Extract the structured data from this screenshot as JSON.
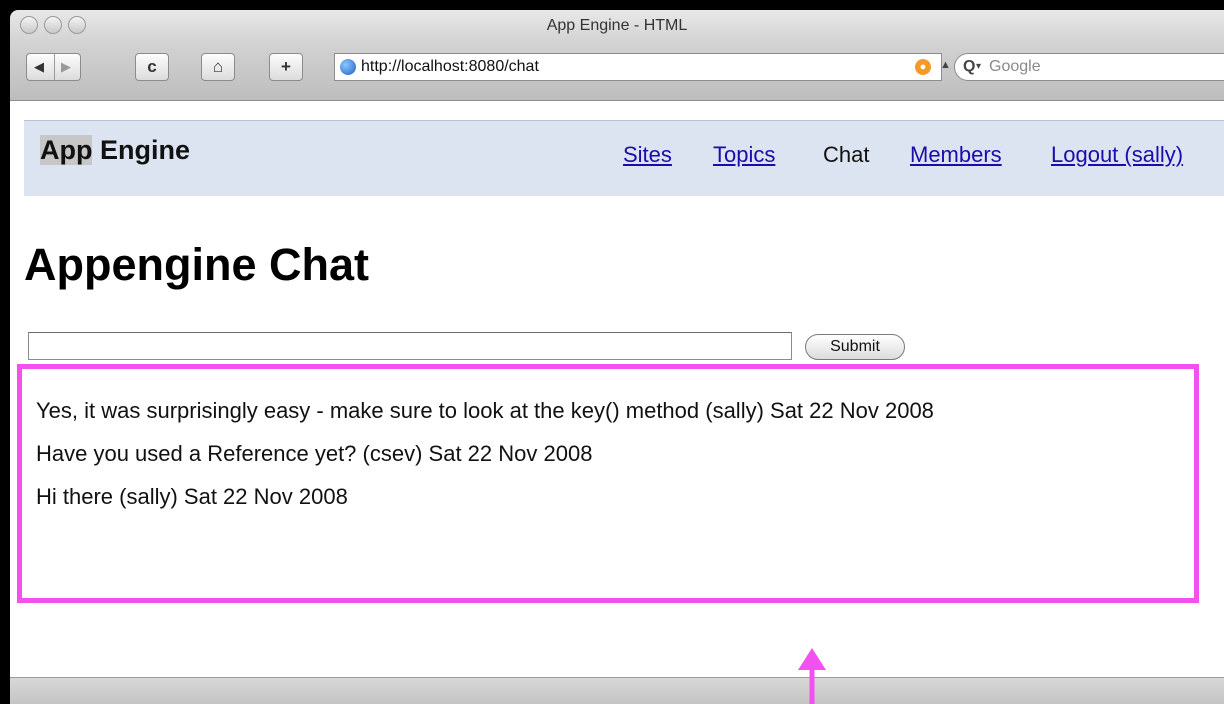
{
  "window": {
    "title": "App Engine - HTML"
  },
  "toolbar": {
    "back_icon": "back-arrow-icon",
    "forward_icon": "forward-arrow-icon",
    "reload_label": "c",
    "home_icon": "home-icon",
    "add_label": "+",
    "url": "http://localhost:8080/chat",
    "search_placeholder": "Google",
    "search_icon_label": "Q"
  },
  "nav": {
    "brand_highlight": "App",
    "brand_rest": " Engine",
    "links": [
      "Sites",
      "Topics",
      "Chat",
      "Members",
      "Logout (sally)"
    ],
    "current": "Chat"
  },
  "main": {
    "title": "Appengine Chat",
    "input_value": "",
    "submit_label": "Submit",
    "messages": [
      "Yes, it was surprisingly easy - make sure to look at the key() method (sally) Sat 22 Nov 2008",
      "Have you used a Reference yet? (csev) Sat 22 Nov 2008",
      "Hi there (sally) Sat 22 Nov 2008"
    ]
  },
  "colors": {
    "annotation": "#f251f0",
    "navbar_bg": "#dbe4f0",
    "link": "#1a0dab"
  }
}
